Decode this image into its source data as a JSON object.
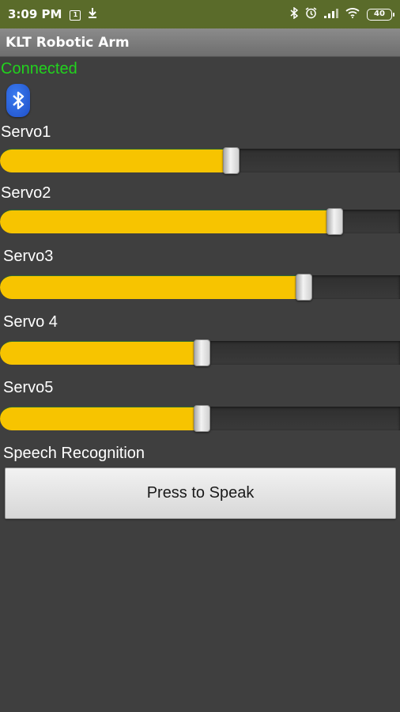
{
  "statusbar": {
    "time": "3:09 PM",
    "notification_box": "1",
    "battery": "40"
  },
  "app": {
    "title": "KLT Robotic Arm",
    "connection_status": "Connected"
  },
  "servos": [
    {
      "label": "Servo1",
      "value": 58
    },
    {
      "label": "Servo2",
      "value": 84
    },
    {
      "label": "Servo3",
      "value": 76
    },
    {
      "label": "Servo 4",
      "value": 50
    },
    {
      "label": "Servo5",
      "value": 50
    }
  ],
  "speech": {
    "label": "Speech Recognition",
    "button_label": "Press to Speak"
  },
  "colors": {
    "connected": "#22d21e",
    "slider_fill": "#f7c400",
    "background": "#3f3f3f"
  }
}
